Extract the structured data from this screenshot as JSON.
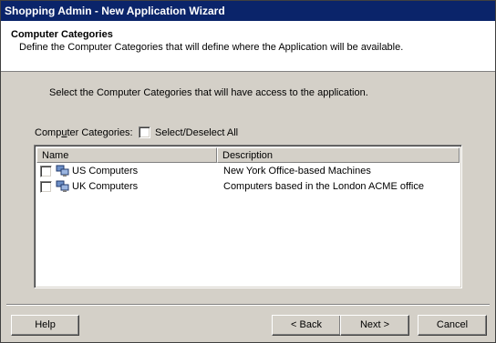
{
  "window": {
    "title": "Shopping Admin - New Application Wizard"
  },
  "header": {
    "title": "Computer Categories",
    "subtitle": "Define the Computer Categories that will define where the Application will be available."
  },
  "instruction": "Select the Computer Categories that will have access to the application.",
  "categories_label": "Computer Categories:",
  "select_all_label": "Select/Deselect All",
  "list": {
    "columns": [
      "Name",
      "Description"
    ],
    "rows": [
      {
        "name": "US Computers",
        "description": "New York Office-based Machines",
        "checked": false
      },
      {
        "name": "UK Computers",
        "description": "Computers based in the London ACME office",
        "checked": false
      }
    ]
  },
  "buttons": {
    "help": "Help",
    "back": "< Back",
    "next": "Next >",
    "cancel": "Cancel"
  },
  "colors": {
    "titlebar": "#0a246a",
    "face": "#d4d0c8"
  },
  "icons": {
    "row_icon": "computer-group-icon"
  }
}
